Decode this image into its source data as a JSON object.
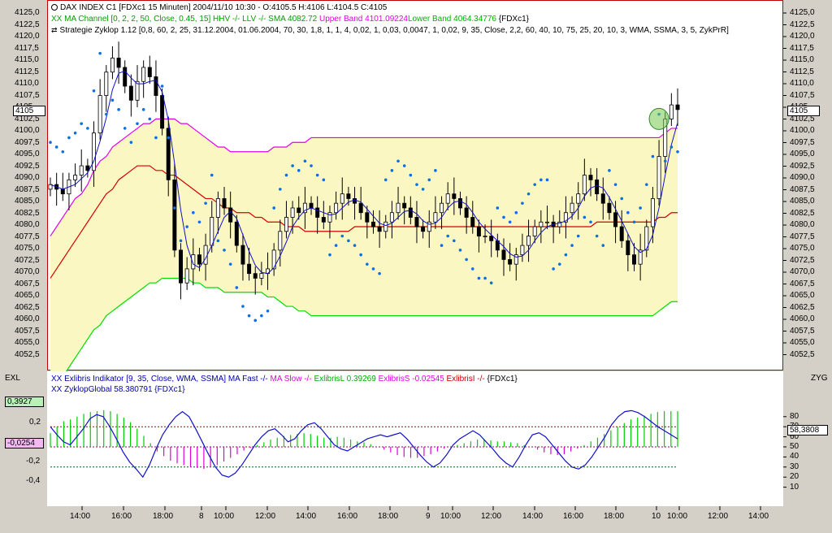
{
  "colors": {
    "panel_bg": "#ffffff",
    "channel_fill": "#fbf7c3",
    "upper_band": "#e400e4",
    "lower_band": "#00dd00",
    "sma": "#d40000",
    "ma_blue": "#1010cc",
    "sar_dots": "#0a6fe0",
    "candles": "#000000",
    "hist_pos": "#00cc00",
    "hist_neg": "#dd00dd",
    "osc_line": "#1010cc",
    "ref_line_red": "#aa0000",
    "ref_line_green": "#006600",
    "border_red": "#c00000"
  },
  "header": {
    "line1": "DAX INDEX C1 [FDXc1  15 Minuten] 2004/11/10 10:30 - O:4105.5 H:4106 L:4104.5 C:4105",
    "line2_prefix": "XX MA Channel [0, 2, 2, 50, Close, 0.45, 15] HHV -/- LLV -/- SMA 4082.72 ",
    "line2_upper": "Upper Band 4101.09224",
    "line2_lower": "Lower Band 4064.34776",
    "line2_suffix": " {FDXc1}",
    "line3": "Strategie Zyklop 1.12 [0,8, 60, 2, 25, 31.12.2004, 01.06.2004, 70, 30, 1,8, 1, 1, 4, 0,02, 1, 0,03, 0,0047, 1, 0,02, 9, 35, Close, 2,2, 60, 40, 10, 75, 25, 20, 10, 3, WMA, SSMA, 3, 5, ZykPrR]"
  },
  "price_axis": {
    "left_ticks": [
      "4125,0",
      "4122,5",
      "4120,0",
      "4117,5",
      "4115,0",
      "4112,5",
      "4110,0",
      "4107,5",
      "4105",
      "4102,5",
      "4100,0",
      "4097,5",
      "4095,0",
      "4092,5",
      "4090,0",
      "4087,5",
      "4085,0",
      "4082,5",
      "4080,0",
      "4077,5",
      "4075,0",
      "4072,5",
      "4070,0",
      "4067,5",
      "4065,0",
      "4062,5",
      "4060,0",
      "4057,5",
      "4055,0",
      "4052,5"
    ],
    "right_ticks": [
      "4125,0",
      "4122,5",
      "4120,0",
      "4117,5",
      "4115,0",
      "4112,5",
      "4110,0",
      "4107,5",
      "4105",
      "4102,5",
      "4100,0",
      "4097,5",
      "4095,0",
      "4092,5",
      "4090,0",
      "4087,5",
      "4085,0",
      "4082,5",
      "4080,0",
      "4077,5",
      "4075,0",
      "4072,5",
      "4070,0",
      "4067,5",
      "4065,0",
      "4062,5",
      "4060,0",
      "4057,5",
      "4055,0",
      "4052,5"
    ],
    "current_left": "4105",
    "current_right": "4105"
  },
  "osc": {
    "left_title": "EXL",
    "right_title": "ZYG",
    "line1_prefix": "XX Exlibris Indikator [9, 35, Close, WMA, SSMA] MA Fast -/- ",
    "line1_slow": "MA Slow -/- ",
    "line1_exl": "ExlibrisL 0.39269 ",
    "line1_exs": "ExlibrisS -0.02545 ",
    "line1_exi": "ExlibrisI -/- ",
    "line1_suffix": "{FDXc1}",
    "line2": "XX ZyklopGlobal 58.380791 {FDXc1}",
    "left_ticks": [
      "0,2",
      "-0,2",
      "-0,4"
    ],
    "left_box_pos": "0,3927",
    "left_box_neg": "-0,0254",
    "right_ticks": [
      "80",
      "70",
      "60",
      "50",
      "40",
      "30",
      "20",
      "10"
    ],
    "right_box": "58,3808"
  },
  "time_axis": {
    "labels": [
      "14:00",
      "16:00",
      "18:00",
      "8",
      "10:00",
      "12:00",
      "14:00",
      "16:00",
      "18:00",
      "9",
      "10:00",
      "12:00",
      "14:00",
      "16:00",
      "18:00",
      "10",
      "10:00",
      "12:00",
      "14:00"
    ]
  },
  "chart_data": [
    {
      "type": "candlestick",
      "title": "DAX INDEX C1 [FDXc1  15 Minuten]",
      "ylim": [
        4050,
        4127
      ],
      "legend": [
        "XX MA Channel Upper Band",
        "XX MA Channel Lower Band",
        "SMA",
        "Strategie Zyklop 1.12"
      ],
      "close": [
        4089,
        4088,
        4087,
        4090,
        4091,
        4093,
        4092,
        4100,
        4108,
        4113,
        4116,
        4114,
        4110,
        4107,
        4111,
        4114,
        4112,
        4108,
        4101,
        4090,
        4075,
        4068,
        4071,
        4074,
        4072,
        4076,
        4082,
        4086,
        4084,
        4081,
        4076,
        4072,
        4070,
        4069,
        4070,
        4071,
        4075,
        4079,
        4082,
        4084,
        4083,
        4085,
        4084,
        4082,
        4081,
        4083,
        4085,
        4087,
        4086,
        4085,
        4083,
        4081,
        4080,
        4079,
        4081,
        4083,
        4085,
        4084,
        4082,
        4080,
        4079,
        4081,
        4083,
        4085,
        4087,
        4086,
        4084,
        4082,
        4080,
        4078,
        4078,
        4077,
        4075,
        4073,
        4072,
        4074,
        4076,
        4078,
        4080,
        4081,
        4081,
        4080,
        4081,
        4083,
        4085,
        4087,
        4091,
        4090,
        4087,
        4085,
        4083,
        4080,
        4077,
        4074,
        4072,
        4075,
        4080,
        4086,
        4095,
        4103,
        4106,
        4105
      ],
      "upper_band": [
        4078,
        4080,
        4082,
        4084,
        4086,
        4087,
        4089,
        4092,
        4094,
        4095,
        4097,
        4098,
        4099,
        4100,
        4101,
        4102,
        4102,
        4103,
        4103,
        4103,
        4103,
        4102,
        4102,
        4101,
        4100,
        4099,
        4098,
        4097,
        4097,
        4096,
        4096,
        4096,
        4096,
        4096,
        4096,
        4096,
        4097,
        4097,
        4097,
        4098,
        4098,
        4098,
        4099,
        4099,
        4099,
        4099,
        4099,
        4099,
        4099,
        4099,
        4099,
        4099,
        4099,
        4099,
        4099,
        4099,
        4099,
        4099,
        4099,
        4099,
        4099,
        4099,
        4099,
        4099,
        4099,
        4099,
        4099,
        4099,
        4099,
        4099,
        4099,
        4099,
        4099,
        4099,
        4099,
        4099,
        4099,
        4099,
        4099,
        4099,
        4099,
        4099,
        4099,
        4099,
        4099,
        4099,
        4099,
        4099,
        4099,
        4099,
        4099,
        4099,
        4099,
        4099,
        4099,
        4099,
        4099,
        4099,
        4099,
        4100,
        4101,
        4101
      ],
      "lower_band": [
        4044,
        4046,
        4048,
        4050,
        4052,
        4054,
        4056,
        4058,
        4059,
        4061,
        4062,
        4063,
        4064,
        4065,
        4066,
        4067,
        4068,
        4068,
        4069,
        4069,
        4069,
        4069,
        4069,
        4068,
        4068,
        4067,
        4067,
        4067,
        4066,
        4066,
        4066,
        4066,
        4066,
        4066,
        4066,
        4065,
        4065,
        4064,
        4063,
        4063,
        4062,
        4062,
        4061,
        4061,
        4061,
        4061,
        4061,
        4061,
        4061,
        4061,
        4061,
        4061,
        4061,
        4061,
        4061,
        4061,
        4061,
        4061,
        4061,
        4061,
        4061,
        4061,
        4061,
        4061,
        4061,
        4061,
        4061,
        4061,
        4061,
        4061,
        4061,
        4061,
        4061,
        4061,
        4061,
        4061,
        4061,
        4061,
        4061,
        4061,
        4061,
        4061,
        4061,
        4061,
        4061,
        4061,
        4061,
        4061,
        4061,
        4061,
        4061,
        4061,
        4061,
        4061,
        4061,
        4061,
        4061,
        4061,
        4062,
        4063,
        4064,
        4064
      ],
      "sma": [
        4069,
        4071,
        4073,
        4075,
        4077,
        4079,
        4081,
        4083,
        4085,
        4087,
        4088,
        4090,
        4091,
        4092,
        4093,
        4093,
        4093,
        4092,
        4092,
        4091,
        4091,
        4090,
        4089,
        4088,
        4087,
        4086,
        4086,
        4085,
        4084,
        4084,
        4083,
        4083,
        4083,
        4082,
        4082,
        4081,
        4081,
        4081,
        4080,
        4080,
        4080,
        4079,
        4079,
        4079,
        4079,
        4079,
        4079,
        4079,
        4079,
        4080,
        4080,
        4080,
        4080,
        4080,
        4080,
        4080,
        4080,
        4080,
        4080,
        4080,
        4080,
        4080,
        4080,
        4080,
        4080,
        4080,
        4080,
        4080,
        4080,
        4080,
        4080,
        4080,
        4080,
        4080,
        4080,
        4080,
        4080,
        4080,
        4080,
        4080,
        4080,
        4080,
        4080,
        4080,
        4080,
        4080,
        4080,
        4080,
        4081,
        4081,
        4081,
        4081,
        4081,
        4081,
        4081,
        4081,
        4081,
        4081,
        4082,
        4082,
        4083,
        4083
      ]
    },
    {
      "type": "bar",
      "title": "XX Exlibris Indikator [9, 35, Close, WMA, SSMA]",
      "ylim": [
        -0.6,
        0.5
      ],
      "series": [
        {
          "name": "ExlibrisL",
          "values": [
            0.15,
            0.22,
            0.28,
            0.3,
            0.33,
            0.36,
            0.38,
            0.39,
            0.4,
            0.39,
            0.36,
            0.32,
            0.27,
            0.2,
            0.12,
            0.04,
            -0.05,
            -0.1,
            -0.15,
            -0.18,
            -0.2,
            -0.22,
            -0.23,
            -0.24,
            -0.22,
            -0.2,
            -0.16,
            -0.12,
            -0.08,
            -0.04,
            -0.01,
            0.02,
            0.05,
            0.08,
            0.1,
            0.12,
            0.13,
            0.14,
            0.15,
            0.14,
            0.12,
            0.1,
            0.1,
            0.11,
            0.1,
            0.08,
            0.06,
            0.05,
            0.03,
            0.0,
            -0.03,
            -0.06,
            -0.09,
            -0.11,
            -0.12,
            -0.12,
            -0.1,
            -0.08,
            -0.05,
            -0.02,
            0.0,
            0.02,
            0.04,
            0.06,
            0.08,
            0.08,
            0.07,
            0.06,
            0.06,
            0.05,
            0.04,
            0.02,
            0.0,
            -0.03,
            -0.06,
            -0.08,
            -0.09,
            -0.08,
            -0.05,
            -0.02,
            0.02,
            0.06,
            0.1,
            0.14,
            0.18,
            0.22,
            0.26,
            0.3,
            0.32,
            0.34,
            0.36,
            0.38,
            0.39,
            0.39,
            0.39
          ]
        }
      ]
    },
    {
      "type": "line",
      "title": "XX ZyklopGlobal",
      "ylim": [
        0,
        100
      ],
      "series": [
        {
          "name": "ZyklopGlobal",
          "values": [
            70,
            62,
            55,
            52,
            60,
            68,
            78,
            82,
            80,
            70,
            58,
            45,
            35,
            28,
            20,
            32,
            48,
            62,
            72,
            80,
            85,
            80,
            68,
            55,
            42,
            30,
            22,
            20,
            24,
            32,
            42,
            52,
            60,
            66,
            68,
            62,
            55,
            58,
            66,
            72,
            74,
            68,
            60,
            52,
            48,
            46,
            50,
            54,
            58,
            60,
            62,
            60,
            62,
            64,
            58,
            50,
            42,
            35,
            30,
            34,
            42,
            52,
            58,
            62,
            66,
            62,
            55,
            48,
            40,
            34,
            30,
            40,
            52,
            62,
            64,
            60,
            52,
            44,
            36,
            30,
            28,
            32,
            40,
            50,
            60,
            72,
            80,
            85,
            86,
            84,
            80,
            75,
            70,
            66,
            62,
            58
          ]
        }
      ]
    }
  ]
}
